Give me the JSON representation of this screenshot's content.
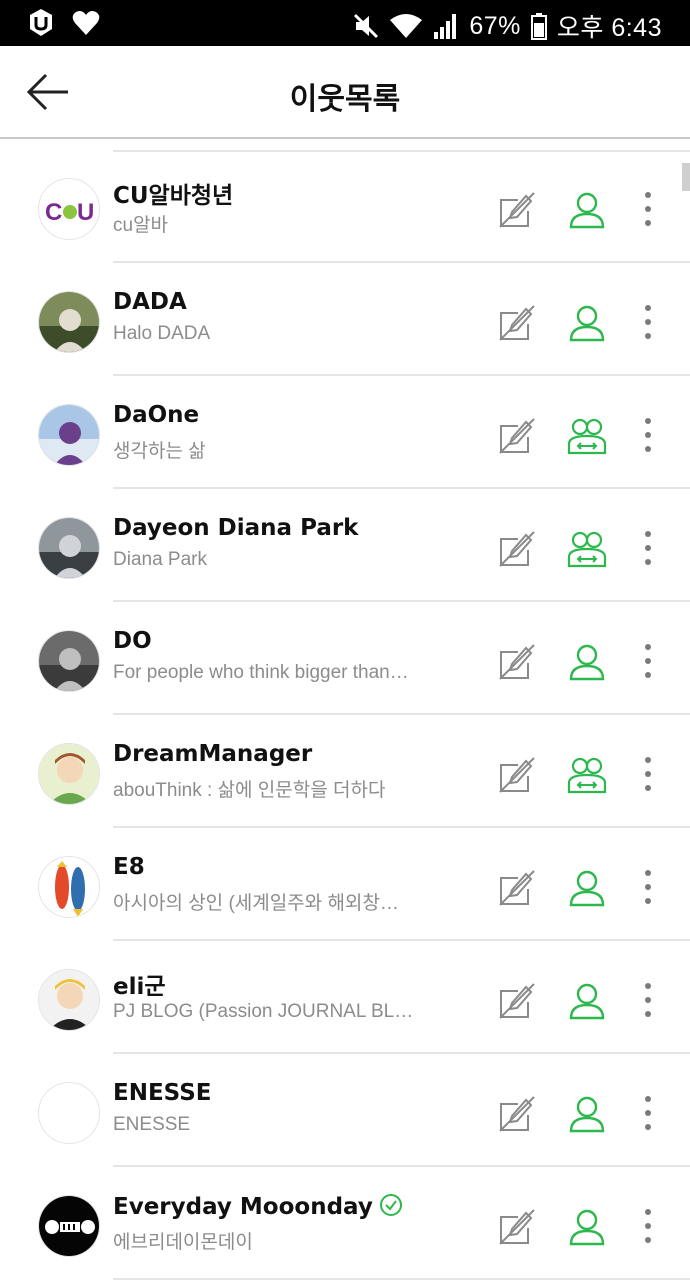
{
  "status_bar": {
    "battery": "67%",
    "time": "오후 6:43",
    "icons": [
      "carrier-u-icon",
      "heart-icon",
      "mute-icon",
      "wifi-icon",
      "signal-icon",
      "battery-icon"
    ]
  },
  "header": {
    "title": "이웃목록",
    "back_icon": "arrow-left-icon"
  },
  "colors": {
    "accent_green": "#2db84d",
    "icon_gray": "#8a8a8a",
    "divider": "#e5e5e5"
  },
  "neighbors": [
    {
      "name": "CU알바청년",
      "desc": "cu알바",
      "relation": "neighbor",
      "avatar": "cu-logo"
    },
    {
      "name": "DADA",
      "desc": "Halo DADA",
      "relation": "neighbor",
      "avatar": "photo"
    },
    {
      "name": "DaOne",
      "desc": "생각하는 삶",
      "relation": "mutual",
      "avatar": "photo"
    },
    {
      "name": "Dayeon Diana Park",
      "desc": "Diana Park",
      "relation": "mutual",
      "avatar": "photo"
    },
    {
      "name": "DO",
      "desc": "For people who think bigger than…",
      "relation": "neighbor",
      "avatar": "photo"
    },
    {
      "name": "DreamManager",
      "desc": "abouThink : 삶에 인문학을 더하다",
      "relation": "mutual",
      "avatar": "illustration"
    },
    {
      "name": "E8",
      "desc": "아시아의 상인 (세계일주와 해외창…",
      "relation": "neighbor",
      "avatar": "fish-illustration"
    },
    {
      "name": "eli군",
      "desc": "PJ BLOG (Passion JOURNAL BL…",
      "relation": "neighbor",
      "avatar": "illustration"
    },
    {
      "name": "ENESSE",
      "desc": "ENESSE",
      "relation": "neighbor",
      "avatar": "empty"
    },
    {
      "name": "Everyday Mooonday",
      "desc": "에브리데이몬데이",
      "relation": "neighbor",
      "avatar": "logo",
      "verified": true
    }
  ]
}
